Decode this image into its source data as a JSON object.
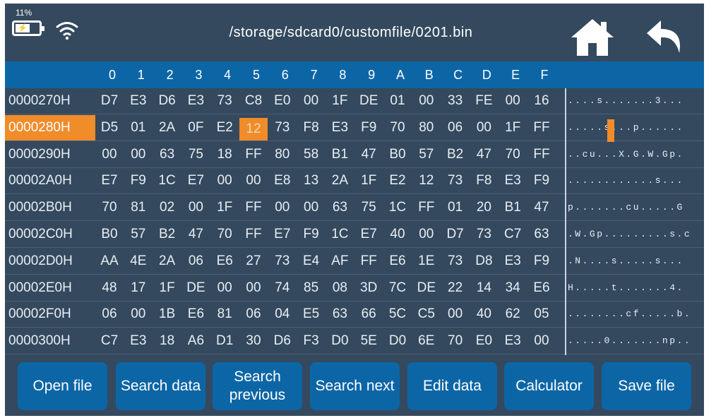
{
  "status": {
    "battery_percent": "11%",
    "battery_icon": "battery-charging-icon",
    "wifi_icon": "wifi-icon"
  },
  "header": {
    "file_path": "/storage/sdcard0/customfile/0201.bin",
    "home_icon": "home-icon",
    "back_icon": "back-arrow-icon"
  },
  "columns": [
    "0",
    "1",
    "2",
    "3",
    "4",
    "5",
    "6",
    "7",
    "8",
    "9",
    "A",
    "B",
    "C",
    "D",
    "E",
    "F"
  ],
  "rows": [
    {
      "addr": "0000270H",
      "bytes": [
        "D7",
        "E3",
        "D6",
        "E3",
        "73",
        "C8",
        "E0",
        "00",
        "1F",
        "DE",
        "01",
        "00",
        "33",
        "FE",
        "00",
        "16"
      ],
      "ascii": "....s.......3..."
    },
    {
      "addr": "0000280H",
      "bytes": [
        "D5",
        "01",
        "2A",
        "0F",
        "E2",
        "12",
        "73",
        "F8",
        "E3",
        "F9",
        "70",
        "80",
        "06",
        "00",
        "1F",
        "FF"
      ],
      "ascii": ".....s...p......"
    },
    {
      "addr": "0000290H",
      "bytes": [
        "00",
        "00",
        "63",
        "75",
        "18",
        "FF",
        "80",
        "58",
        "B1",
        "47",
        "B0",
        "57",
        "B2",
        "47",
        "70",
        "FF"
      ],
      "ascii": "..cu...X.G.W.Gp."
    },
    {
      "addr": "00002A0H",
      "bytes": [
        "E7",
        "F9",
        "1C",
        "E7",
        "00",
        "00",
        "E8",
        "13",
        "2A",
        "1F",
        "E2",
        "12",
        "73",
        "F8",
        "E3",
        "F9"
      ],
      "ascii": "............s..."
    },
    {
      "addr": "00002B0H",
      "bytes": [
        "70",
        "81",
        "02",
        "00",
        "1F",
        "FF",
        "00",
        "00",
        "63",
        "75",
        "1C",
        "FF",
        "01",
        "20",
        "B1",
        "47"
      ],
      "ascii": "p.......cu.....G"
    },
    {
      "addr": "00002C0H",
      "bytes": [
        "B0",
        "57",
        "B2",
        "47",
        "70",
        "FF",
        "E7",
        "F9",
        "1C",
        "E7",
        "40",
        "00",
        "D7",
        "73",
        "C7",
        "63"
      ],
      "ascii": ".W.Gp.........s.c"
    },
    {
      "addr": "00002D0H",
      "bytes": [
        "AA",
        "4E",
        "2A",
        "06",
        "E6",
        "27",
        "73",
        "E4",
        "AF",
        "FF",
        "E6",
        "1E",
        "73",
        "D8",
        "E3",
        "F9"
      ],
      "ascii": ".N....s.....s..."
    },
    {
      "addr": "00002E0H",
      "bytes": [
        "48",
        "17",
        "1F",
        "DE",
        "00",
        "00",
        "74",
        "85",
        "08",
        "3D",
        "7C",
        "DE",
        "22",
        "14",
        "34",
        "E6"
      ],
      "ascii": "H.....t.......4."
    },
    {
      "addr": "00002F0H",
      "bytes": [
        "06",
        "00",
        "1B",
        "E6",
        "81",
        "06",
        "04",
        "E5",
        "63",
        "66",
        "5C",
        "C5",
        "00",
        "40",
        "62",
        "05"
      ],
      "ascii": "........cf.....b."
    },
    {
      "addr": "0000300H",
      "bytes": [
        "C7",
        "E3",
        "18",
        "A6",
        "D1",
        "30",
        "D6",
        "F3",
        "D0",
        "5E",
        "D0",
        "6E",
        "70",
        "E0",
        "E3",
        "00"
      ],
      "ascii": ".....0.......np.."
    }
  ],
  "selection": {
    "row": 1,
    "col": 5
  },
  "buttons": {
    "open_file": "Open file",
    "search_data": "Search data",
    "search_previous": "Search previous",
    "search_next": "Search next",
    "edit_data": "Edit data",
    "calculator": "Calculator",
    "save_file": "Save file"
  },
  "colors": {
    "background": "#34495e",
    "header_bar": "#0c66a6",
    "highlight": "#f08c2a"
  }
}
